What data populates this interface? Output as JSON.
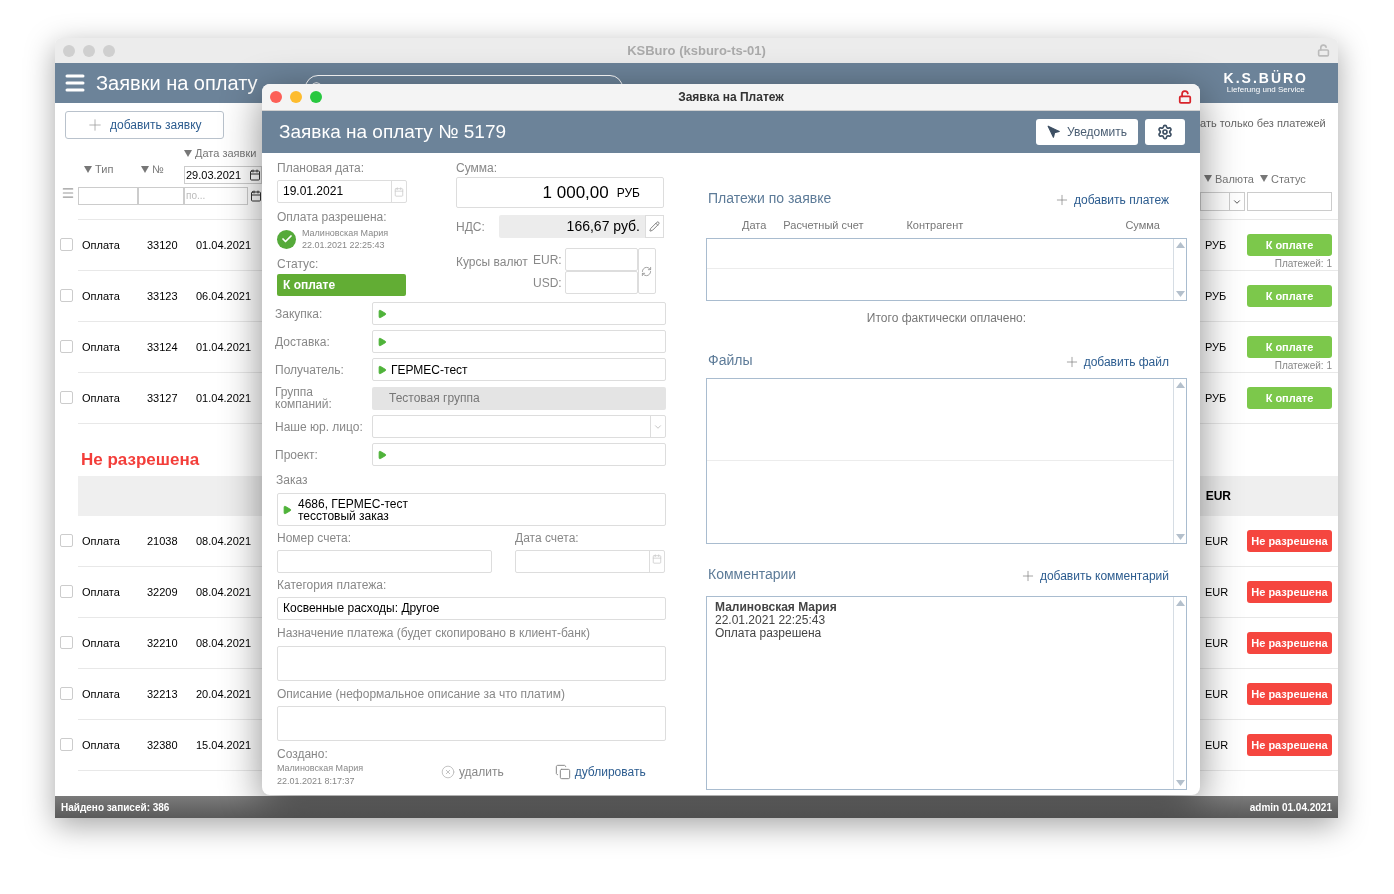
{
  "window": {
    "title": "KSBuro (ksburo-ts-01)"
  },
  "app_header": {
    "title": "Заявки на оплату",
    "logo": "K.S.BÜRO",
    "logo_subtitle": "Lieferung und Service"
  },
  "toolbar": {
    "add_button": "добавить заявку",
    "filter_option": "ать только без платежей"
  },
  "columns_left": [
    {
      "label": "Тип"
    },
    {
      "label": "№"
    },
    {
      "label": "Дата заявки"
    }
  ],
  "columns_right": [
    {
      "label": "Валюта"
    },
    {
      "label": "Статус"
    }
  ],
  "filters": {
    "date_from": "29.03.2021",
    "date_to_placeholder": "по..."
  },
  "rows": [
    {
      "kind": "row",
      "checked": false,
      "type": "Оплата",
      "number": "33120",
      "date": "01.04.2021",
      "currency": "РУБ",
      "status": "К оплате",
      "color": "#7cc84b",
      "note": "Платежей: 1"
    },
    {
      "kind": "row",
      "checked": false,
      "type": "Оплата",
      "number": "33123",
      "date": "06.04.2021",
      "currency": "РУБ",
      "status": "К оплате",
      "color": "#7cc84b"
    },
    {
      "kind": "row",
      "checked": false,
      "type": "Оплата",
      "number": "33124",
      "date": "01.04.2021",
      "currency": "РУБ",
      "status": "К оплате",
      "color": "#7cc84b",
      "note": "Платежей: 1"
    },
    {
      "kind": "row",
      "checked": false,
      "type": "Оплата",
      "number": "33127",
      "date": "01.04.2021",
      "currency": "РУБ",
      "status": "К оплате",
      "color": "#7cc84b"
    },
    {
      "kind": "group",
      "title": "Не разрешена"
    },
    {
      "kind": "subgroup",
      "currency": "EUR"
    },
    {
      "kind": "row",
      "checked": false,
      "type": "Оплата",
      "number": "21038",
      "date": "08.04.2021",
      "currency": "EUR",
      "status": "Не разрешена",
      "color": "#f5463f"
    },
    {
      "kind": "row",
      "checked": false,
      "type": "Оплата",
      "number": "32209",
      "date": "08.04.2021",
      "currency": "EUR",
      "status": "Не разрешена",
      "color": "#f5463f"
    },
    {
      "kind": "row",
      "checked": false,
      "type": "Оплата",
      "number": "32210",
      "date": "08.04.2021",
      "currency": "EUR",
      "status": "Не разрешена",
      "color": "#f5463f"
    },
    {
      "kind": "row",
      "checked": false,
      "type": "Оплата",
      "number": "32213",
      "date": "20.04.2021",
      "currency": "EUR",
      "status": "Не разрешена",
      "color": "#f5463f"
    },
    {
      "kind": "row",
      "checked": false,
      "type": "Оплата",
      "number": "32380",
      "date": "15.04.2021",
      "currency": "EUR",
      "status": "Не разрешена",
      "color": "#f5463f"
    }
  ],
  "status_bar": {
    "found": "Найдено записей: 386",
    "user": "admin 01.04.2021"
  },
  "dialog": {
    "title": "Заявка на Платеж",
    "heading": "Заявка на оплату № 5179",
    "notify_button": "Уведомить",
    "plan_date": {
      "label": "Плановая дата:",
      "value": "19.01.2021"
    },
    "approval": {
      "label": "Оплата разрешена:",
      "by": "Малиновская Мария",
      "at": "22.01.2021 22:25:43"
    },
    "status": {
      "label": "Статус:",
      "value": "К оплате",
      "color": "#62ad34"
    },
    "amount": {
      "label": "Сумма:",
      "value": "1 000,00",
      "currency": "РУБ"
    },
    "vat": {
      "label": "НДС:",
      "value": "166,67 руб."
    },
    "rates": {
      "label": "Курсы валют",
      "currencies": [
        {
          "code": "EUR:"
        },
        {
          "code": "USD:"
        }
      ]
    },
    "links": [
      {
        "kind": "link",
        "label": "Закупка:"
      },
      {
        "kind": "link",
        "label": "Доставка:"
      },
      {
        "kind": "link",
        "label": "Получатель:",
        "value": "ГЕРМЕС-тест"
      },
      {
        "kind": "readonly",
        "label": "Группа компаний:",
        "value": "Тестовая группа"
      },
      {
        "kind": "select",
        "label": "Наше юр. лицо:"
      },
      {
        "kind": "link",
        "label": "Проект:"
      }
    ],
    "order": {
      "label": "Заказ",
      "lines": [
        "4686, ГЕРМЕС-тест",
        "тесстовый заказ"
      ]
    },
    "invoice_number": {
      "label": "Номер счета:"
    },
    "invoice_date": {
      "label": "Дата счета:"
    },
    "category": {
      "label": "Категория платежа:",
      "value": "Косвенные расходы: Другое"
    },
    "purpose": {
      "label": "Назначение платежа (будет скопировано в клиент-банк)"
    },
    "description": {
      "label": "Описание (неформальное описание за что платим)"
    },
    "created": {
      "label": "Создано:",
      "by": "Малиновская Мария",
      "at": "22.01.2021 8:17:37"
    },
    "delete_button": "удалить",
    "duplicate_button": "дублировать",
    "payments": {
      "title": "Платежи по заявке",
      "add": "добавить платеж",
      "columns": [
        "Дата",
        "Расчетный счет",
        "Контрагент",
        "Сумма"
      ],
      "total_label": "Итого фактически оплачено:"
    },
    "files": {
      "title": "Файлы",
      "add": "добавить файл"
    },
    "comments": {
      "title": "Комментарии",
      "add": "добавить комментарий",
      "items": [
        {
          "author": "Малиновская Мария",
          "date": "22.01.2021 22:25:43",
          "text": "Оплата разрешена"
        }
      ]
    }
  }
}
